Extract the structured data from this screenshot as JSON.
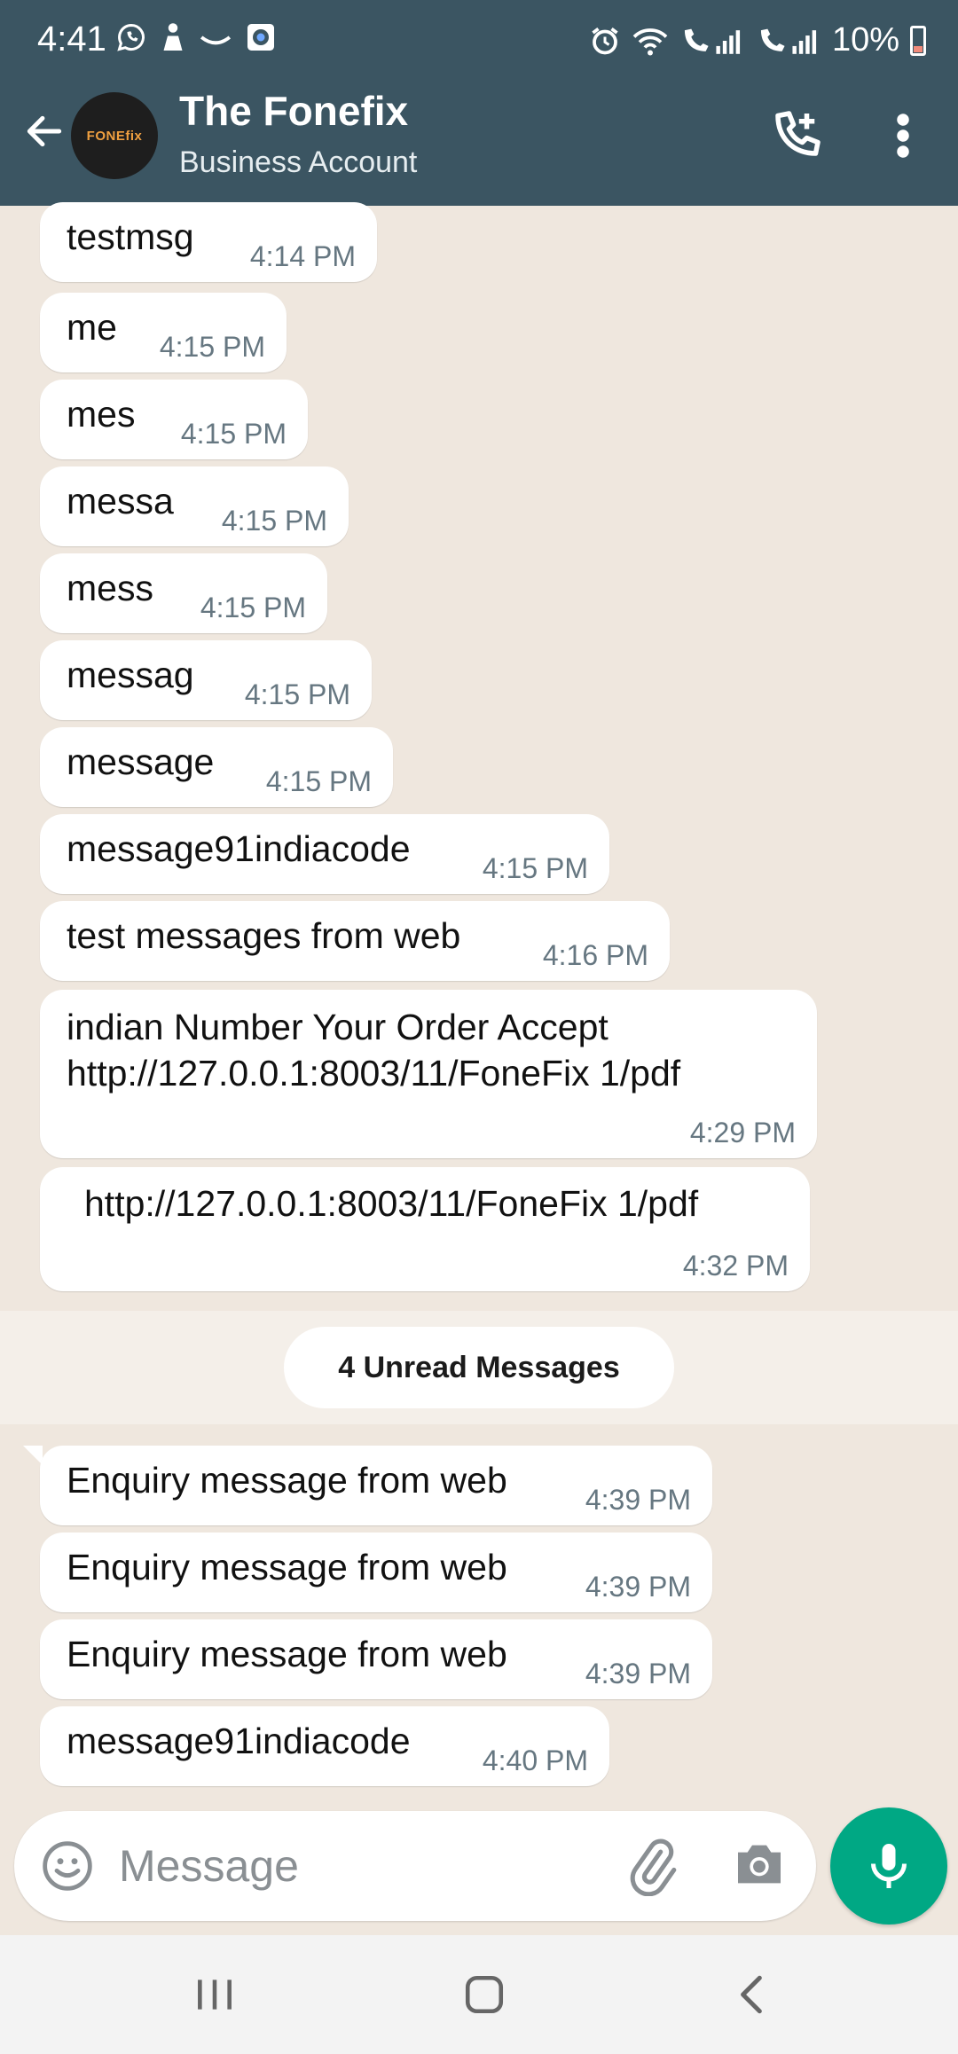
{
  "status_bar": {
    "time": "4:41",
    "battery": "10%",
    "left_icons": [
      "whatsapp-icon",
      "person-icon",
      "smile-icon",
      "camera-app-icon"
    ],
    "right_icons": [
      "alarm-icon",
      "wifi-icon",
      "call-signal-1-icon",
      "call-signal-2-icon"
    ]
  },
  "header": {
    "avatar_text": "FONEfix",
    "name": "The Fonefix",
    "subtitle": "Business Account"
  },
  "messages": [
    {
      "text": "testmsg",
      "time": "4:14 PM"
    },
    {
      "text": "me",
      "time": "4:15 PM"
    },
    {
      "text": "mes",
      "time": "4:15 PM"
    },
    {
      "text": "messa",
      "time": "4:15 PM"
    },
    {
      "text": "mess",
      "time": "4:15 PM"
    },
    {
      "text": "messag",
      "time": "4:15 PM"
    },
    {
      "text": "message",
      "time": "4:15 PM"
    },
    {
      "text": "message91indiacode",
      "time": "4:15 PM"
    },
    {
      "text": "test messages from web",
      "time": "4:16 PM"
    },
    {
      "text": "indian Number Your Order Accept\nhttp://127.0.0.1:8003/11/FoneFix 1/pdf",
      "time": "4:29 PM"
    },
    {
      "text": "http://127.0.0.1:8003/11/FoneFix 1/pdf",
      "time": "4:32 PM"
    }
  ],
  "unread_label": "4 Unread Messages",
  "unread_messages": [
    {
      "text": "Enquiry message from web",
      "time": "4:39 PM"
    },
    {
      "text": "Enquiry message from web",
      "time": "4:39 PM"
    },
    {
      "text": "Enquiry message from web",
      "time": "4:39 PM"
    },
    {
      "text": "message91indiacode",
      "time": "4:40 PM"
    }
  ],
  "input": {
    "placeholder": "Message"
  },
  "colors": {
    "header_bg": "#3b5562",
    "chat_bg": "#efe7de",
    "bubble_bg": "#ffffff",
    "accent": "#00a884"
  }
}
